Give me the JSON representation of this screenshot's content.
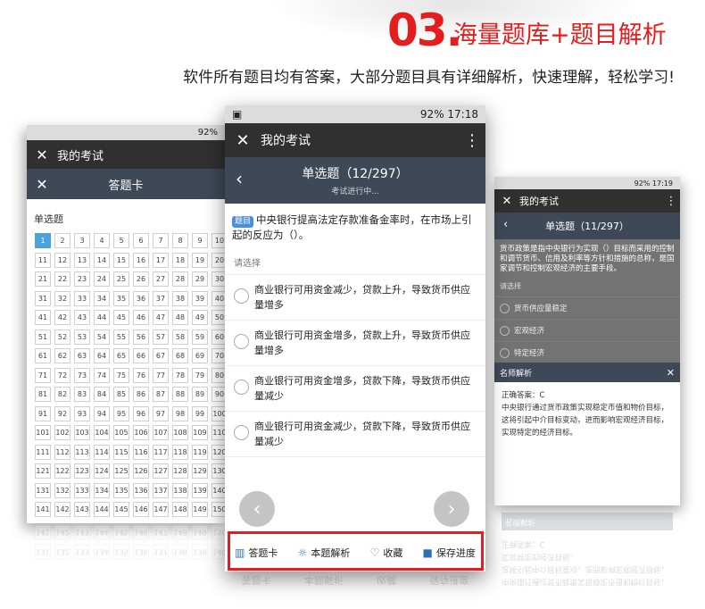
{
  "hero": {
    "number": "03.",
    "title": "海量题库+题目解析",
    "subtitle": "软件所有题目均有答案，大部分题目具有详细解析，快速理解，轻松学习!"
  },
  "left_phone": {
    "status": "92%",
    "app_title": "我的考试",
    "card_title": "答题卡",
    "section_label": "单选题",
    "numbers": [
      "1",
      "2",
      "3",
      "4",
      "5",
      "6",
      "7",
      "8",
      "9",
      "10",
      "11",
      "12",
      "13",
      "14",
      "15",
      "16",
      "17",
      "18",
      "19",
      "20",
      "21",
      "22",
      "23",
      "24",
      "25",
      "26",
      "27",
      "28",
      "29",
      "30",
      "31",
      "32",
      "33",
      "34",
      "35",
      "36",
      "37",
      "38",
      "39",
      "40",
      "41",
      "42",
      "43",
      "44",
      "45",
      "46",
      "47",
      "48",
      "49",
      "50",
      "51",
      "52",
      "53",
      "54",
      "55",
      "56",
      "57",
      "58",
      "59",
      "60",
      "61",
      "62",
      "63",
      "64",
      "65",
      "66",
      "67",
      "68",
      "69",
      "70",
      "71",
      "72",
      "73",
      "74",
      "75",
      "76",
      "77",
      "78",
      "79",
      "80",
      "81",
      "82",
      "83",
      "84",
      "85",
      "86",
      "87",
      "88",
      "89",
      "90",
      "91",
      "92",
      "93",
      "94",
      "95",
      "96",
      "97",
      "98",
      "99",
      "100",
      "101",
      "102",
      "103",
      "104",
      "105",
      "106",
      "107",
      "108",
      "109",
      "110",
      "111",
      "112",
      "113",
      "114",
      "115",
      "116",
      "117",
      "118",
      "119",
      "120",
      "121",
      "122",
      "123",
      "124",
      "125",
      "126",
      "127",
      "128",
      "129",
      "130",
      "131",
      "132",
      "133",
      "134",
      "135",
      "136",
      "137",
      "138",
      "139",
      "140",
      "141",
      "142",
      "143",
      "144",
      "145",
      "146",
      "147",
      "148",
      "149",
      "150"
    ]
  },
  "center_phone": {
    "status_right": "92% 17:18",
    "app_title": "我的考试",
    "question_type": "单选题（12/297）",
    "exam_status": "考试进行中...",
    "tag": "题目",
    "question": "中央银行提高法定存款准备金率时，在市场上引起的反应为（）。",
    "hint": "请选择",
    "options": [
      "商业银行可用资金减少，贷款上升，导致货币供应量增多",
      "商业银行可用资金增多，贷款上升，导致货币供应量增多",
      "商业银行可用资金增多，贷款下降，导致货币供应量减少",
      "商业银行可用资金减少，贷款下降，导致货币供应量减少"
    ],
    "bottom": {
      "card": "答题卡",
      "analysis": "本题解析",
      "favorite": "收藏",
      "save": "保存进度"
    }
  },
  "right_phone": {
    "status": "92% 17:19",
    "app_title": "我的考试",
    "question_type": "单选题（11/297）",
    "question": "货币政策是指中央银行为实现（）目标而采用的控制和调节货币、信用及利率等方针和措施的总称，是国家调节和控制宏观经济的主要手段。",
    "hint": "请选择",
    "options": [
      "货币供应量稳定",
      "宏观经济",
      "特定经济"
    ],
    "panel_title": "名师解析",
    "answer": "正确答案：C",
    "analysis": "中央银行通过货币政策实现稳定币值和物价目标，这将引起中介目标变动，进而影响宏观经济目标，实现特定的经济目标。"
  }
}
